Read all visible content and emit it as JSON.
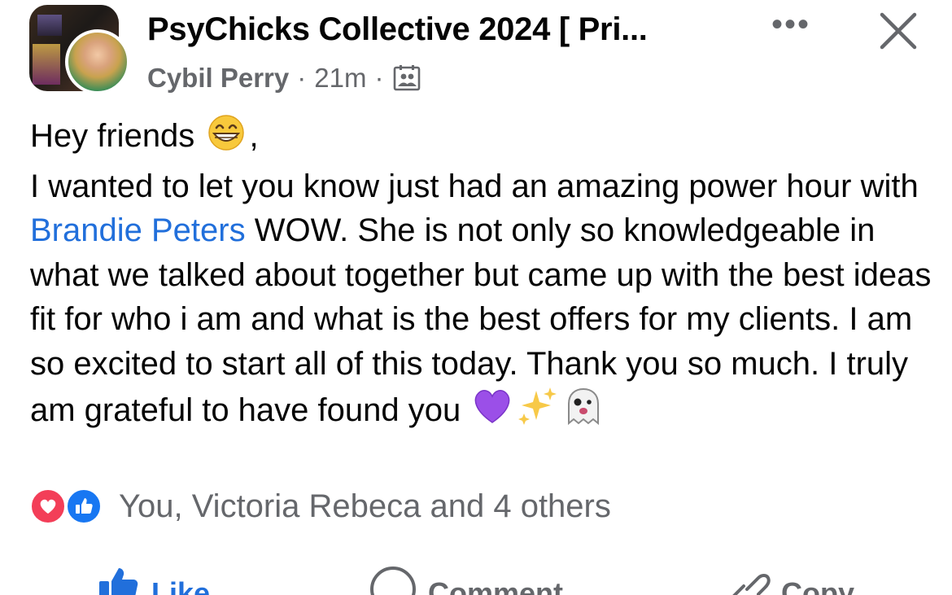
{
  "post": {
    "group_name": "PsyChicks Collective 2024 [ Pri...",
    "author": "Cybil Perry",
    "separator": "·",
    "time_ago": "21m",
    "audience_icon": "group-members-icon",
    "more_label": "•••",
    "close_icon": "close-icon",
    "body": {
      "line1_text": "Hey friends",
      "line1_suffix": ",",
      "emoji_grin": "😁",
      "line2_part1": "I wanted to let you know just had an amazing power hour with ",
      "mention": "Brandie Peters",
      "line2_part2": " WOW. She is not only so knowledgeable in what we talked about together but came up with the best ideas fit for who i am and what is the best offers for my clients. I am so excited to start all of this today. Thank you so much. I truly am grateful to have found you ",
      "emoji_heart": "💜",
      "emoji_sparkles": "✨",
      "emoji_ghost": "👻"
    }
  },
  "reactions": {
    "types": [
      "love",
      "like"
    ],
    "summary": "You, Victoria Rebeca and 4 others"
  },
  "actions": {
    "like_label": "Like",
    "comment_label": "Comment",
    "copy_label": "Copy"
  },
  "colors": {
    "link_blue": "#216fdb",
    "secondary_text": "#65676b",
    "love_red": "#f33e58",
    "like_blue": "#1877f2"
  }
}
